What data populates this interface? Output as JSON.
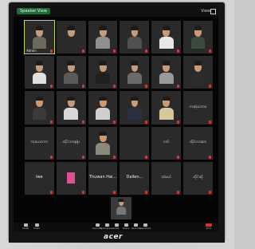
{
  "app": {
    "host_chip": "Speaker View",
    "view_label": "View"
  },
  "participants": [
    {
      "name": "Admin",
      "type": "video",
      "active": true,
      "shirt": "#6d6a5a"
    },
    {
      "name": "",
      "type": "video",
      "shirt": "#2a2a2a"
    },
    {
      "name": "",
      "type": "video",
      "shirt": "#8f8f8f"
    },
    {
      "name": "",
      "type": "video",
      "shirt": "#505050"
    },
    {
      "name": "",
      "type": "video",
      "shirt": "#e8e8e8"
    },
    {
      "name": "",
      "type": "video",
      "shirt": "#3c4c3c"
    },
    {
      "name": "",
      "type": "video",
      "shirt": "#e0e0e0"
    },
    {
      "name": "",
      "type": "video",
      "shirt": "#5a5a5a"
    },
    {
      "name": "",
      "type": "video",
      "shirt": "#202020"
    },
    {
      "name": "",
      "type": "video",
      "shirt": "#6a6a6a"
    },
    {
      "name": "",
      "type": "video",
      "shirt": "#9a9a9a"
    },
    {
      "name": "",
      "type": "video",
      "shirt": "#2c2c2c"
    },
    {
      "name": "",
      "type": "video",
      "shirt": "#3a3a3a"
    },
    {
      "name": "",
      "type": "video",
      "shirt": "#d8d8d8"
    },
    {
      "name": "",
      "type": "video",
      "shirt": "#cfcfcf"
    },
    {
      "name": "",
      "type": "video",
      "shirt": "#2a3040"
    },
    {
      "name": "",
      "type": "video",
      "shirt": "#d6c89a"
    },
    {
      "name": "",
      "type": "text",
      "label": "ကဆုံဘောဝ"
    },
    {
      "name": "",
      "type": "text",
      "label": "ကုယောကာ"
    },
    {
      "name": "",
      "type": "text",
      "label": "ထိုင်ဘာနန်း"
    },
    {
      "name": "",
      "type": "video",
      "shirt": "#8a8a7a"
    },
    {
      "name": "",
      "type": "text",
      "label": ""
    },
    {
      "name": "",
      "type": "text",
      "label": "ဂတ်"
    },
    {
      "name": "",
      "type": "text",
      "label": "ထိုင်လာဆာ"
    },
    {
      "name": "",
      "type": "text",
      "label": "Iwe"
    },
    {
      "name": "",
      "type": "pink",
      "label": ""
    },
    {
      "name": "",
      "type": "text",
      "label": "Thuwan Hai..."
    },
    {
      "name": "",
      "type": "text",
      "label": "Dallen..."
    },
    {
      "name": "",
      "type": "text",
      "label": "ထဲမယ်"
    },
    {
      "name": "",
      "type": "text",
      "label": "ထိုင်ဆို"
    }
  ],
  "spotlight": {
    "name": ""
  },
  "toolbar": {
    "items": [
      {
        "label": "Mute",
        "icon": "microphone-icon"
      },
      {
        "label": "Video",
        "icon": "camera-icon"
      },
      {
        "label": "Security",
        "icon": "shield-icon"
      },
      {
        "label": "Participants",
        "icon": "people-icon"
      },
      {
        "label": "Chat",
        "icon": "chat-icon"
      },
      {
        "label": "Share",
        "icon": "share-icon"
      },
      {
        "label": "Record",
        "icon": "record-icon"
      },
      {
        "label": "Reactions",
        "icon": "reaction-icon"
      },
      {
        "label": "End",
        "icon": "end-call-icon"
      }
    ]
  },
  "monitor": {
    "brand": "acer"
  }
}
